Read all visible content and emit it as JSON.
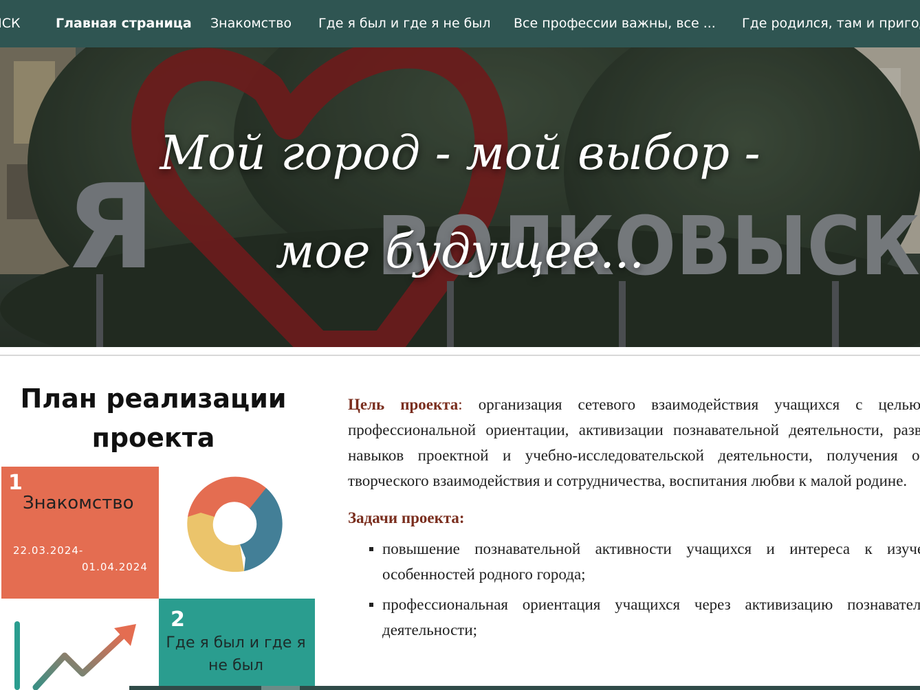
{
  "nav": {
    "items": [
      {
        "label": "ЫСК",
        "active": false
      },
      {
        "label": "Главная страница",
        "active": true
      },
      {
        "label": "Знакомство",
        "active": false
      },
      {
        "label": "Где я был и где я не был",
        "active": false
      },
      {
        "label": "Все профессии важны, все ...",
        "active": false
      },
      {
        "label": "Где родился, там и пригодился",
        "active": false
      }
    ]
  },
  "hero": {
    "line1": "Мой город - мой выбор -",
    "line2": "мое будущее...",
    "sign_letter": "Я",
    "sign_word": "ВОЛКОВЫСК"
  },
  "plan": {
    "title": "План реализации проекта",
    "cards": [
      {
        "number": "1",
        "title": "Знакомство",
        "date_from": "22.03.2024-",
        "date_to": "01.04.2024",
        "color": "#e46d51"
      },
      {
        "number": "2",
        "title": "Где я был и где я не был",
        "color": "#2a9d8f"
      }
    ]
  },
  "content": {
    "goal_label": "Цель проекта",
    "goal_colon": ":",
    "goal_text": "организация сетевого взаимодействия учащихся с целью их профессиональной ориентации, активизации познавательной деятельности, развития навыков проектной и учебно-исследовательской деятельности, получения опыта творческого взаимодействия и сотрудничества, воспитания любви к малой родине.",
    "tasks_label": "Задачи проекта:",
    "tasks": [
      "повышение познавательной активности учащихся и интереса к изучению особенностей родного города;",
      "профессиональная ориентация учащихся через активизацию познавательной деятельности;"
    ]
  },
  "colors": {
    "nav_bg": "#2f5552",
    "accent_text": "#7a2e1e",
    "orange": "#e46d51",
    "teal": "#2a9d8f",
    "yellow": "#ebc46b",
    "blue": "#437f97"
  }
}
